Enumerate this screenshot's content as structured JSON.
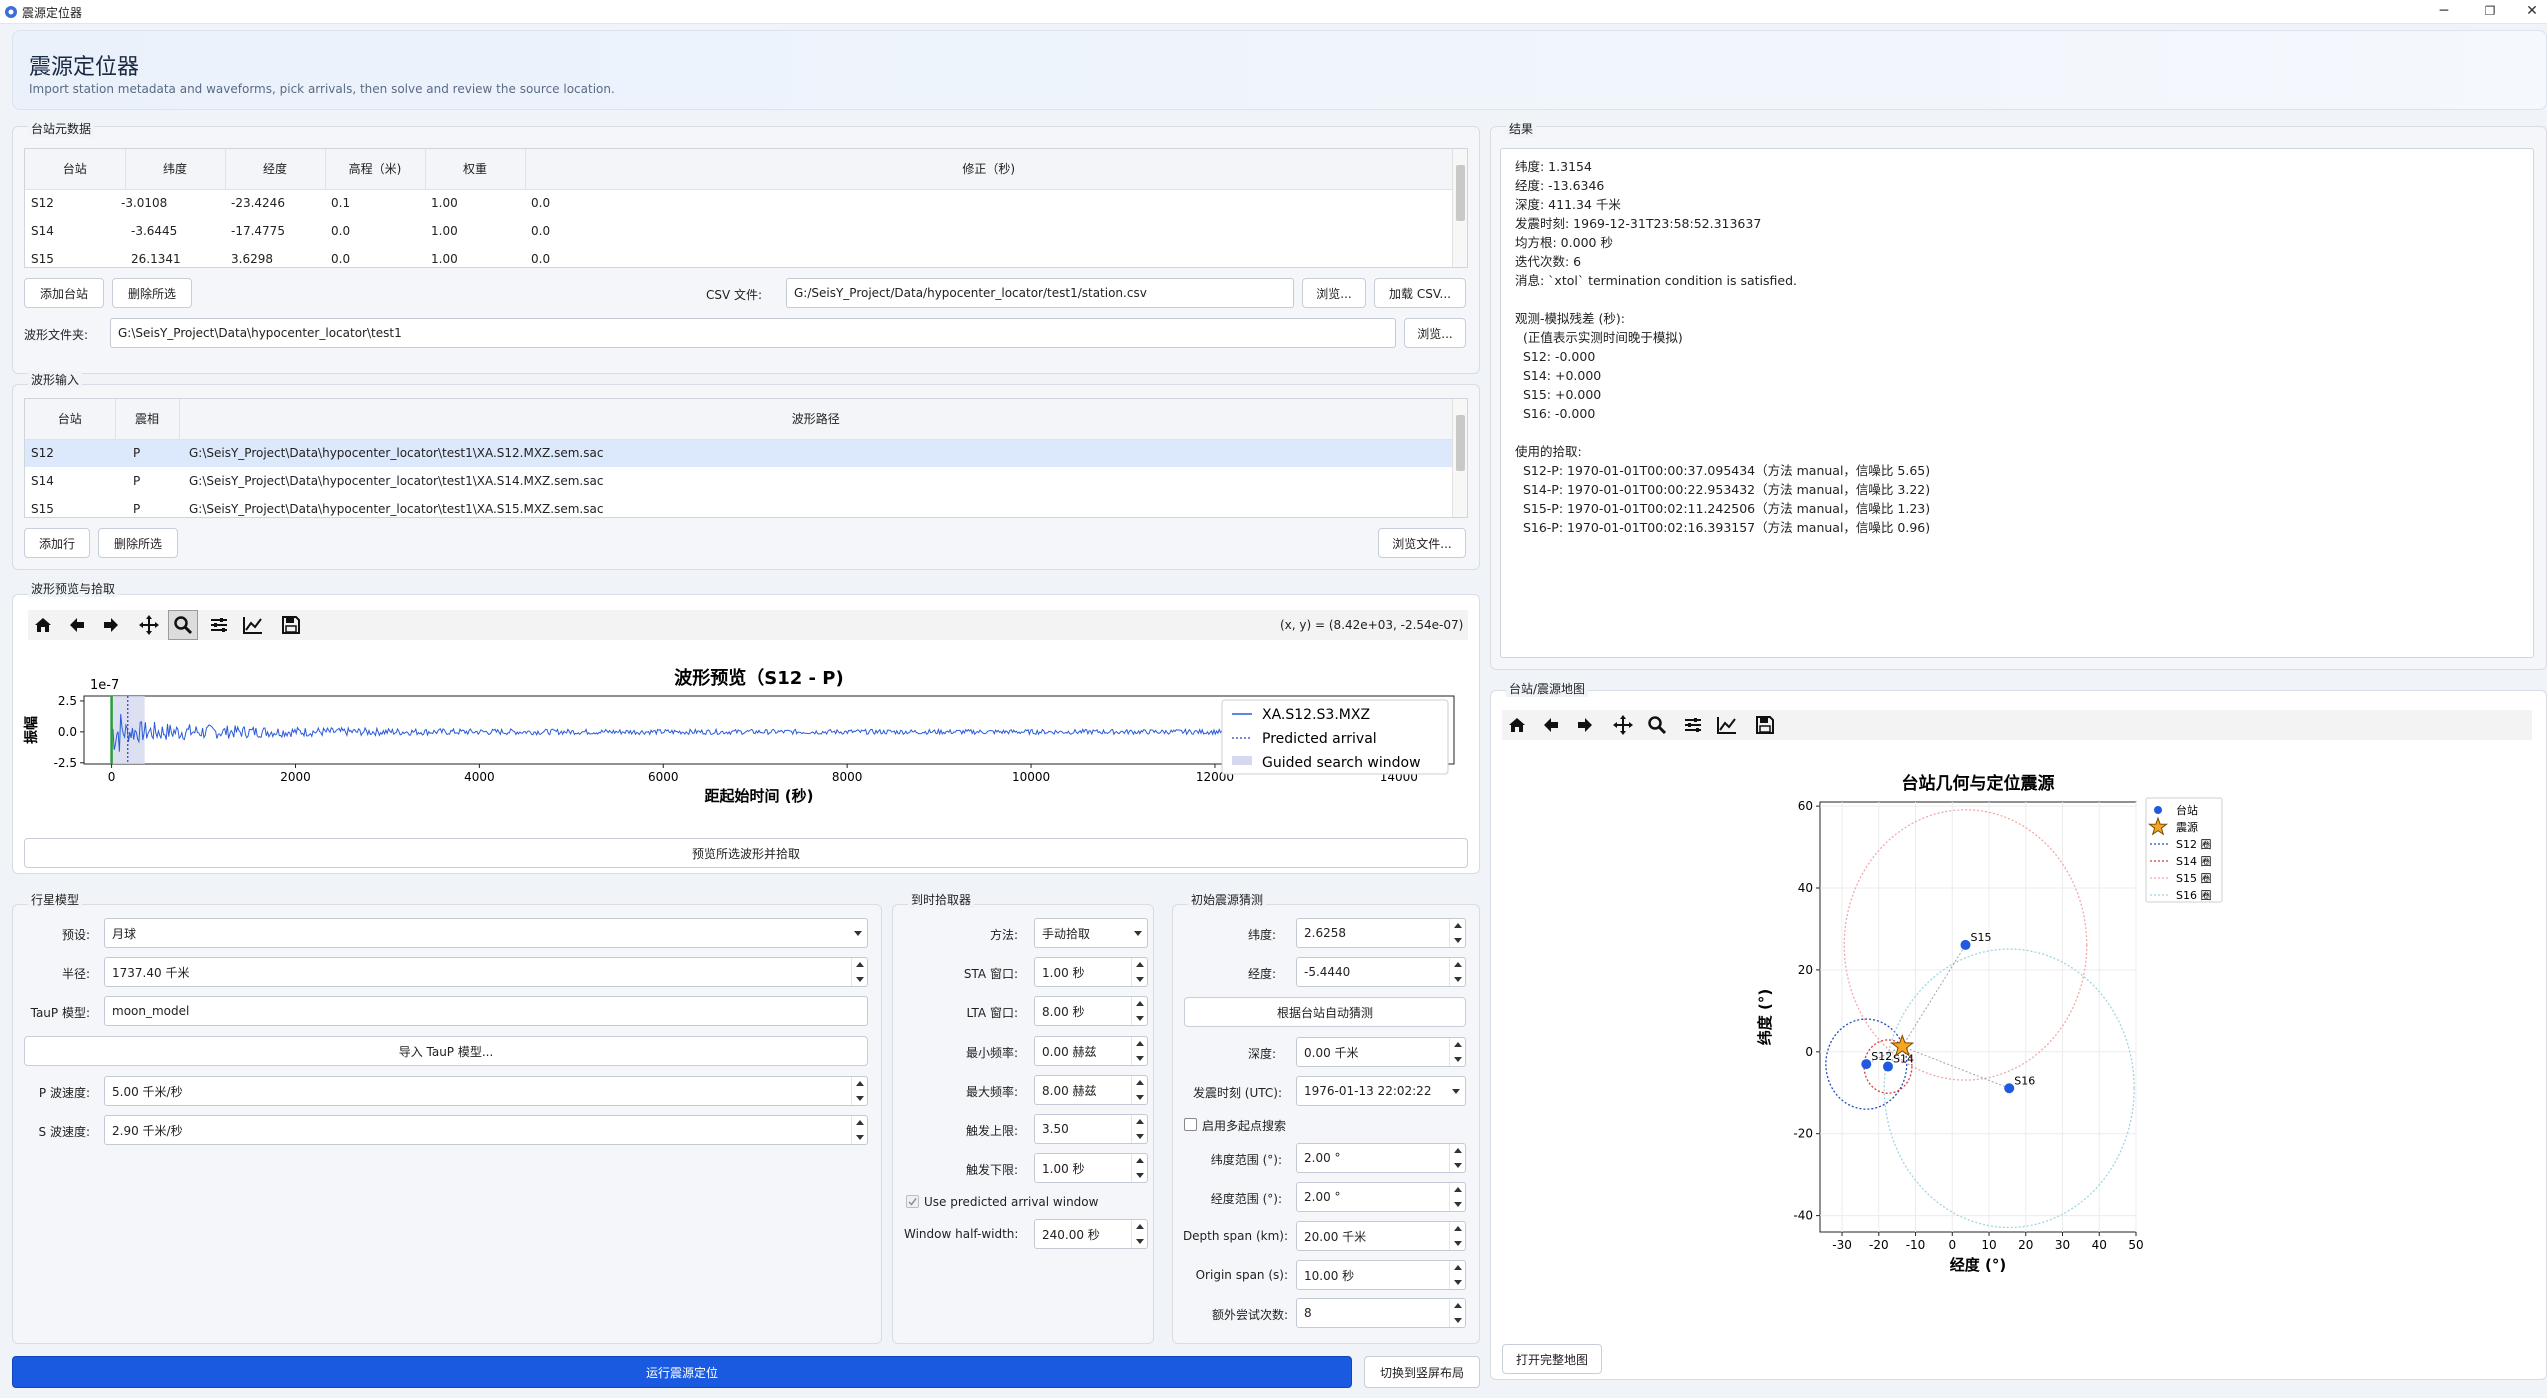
{
  "window": {
    "title": "震源定位器",
    "controls": {
      "minimize": "─",
      "maximize": "❐",
      "close": "✕"
    }
  },
  "header": {
    "title": "震源定位器",
    "subtitle": "Import station metadata and waveforms, pick arrivals, then solve and review the source location."
  },
  "stations": {
    "group_label": "台站元数据",
    "columns": [
      "台站",
      "纬度",
      "经度",
      "高程（米)",
      "权重",
      "修正（秒)"
    ],
    "rows": [
      [
        "S12",
        "-3.0108",
        "-23.4246",
        "0.1",
        "1.00",
        "0.0"
      ],
      [
        "S14",
        "-3.6445",
        "-17.4775",
        "0.0",
        "1.00",
        "0.0"
      ],
      [
        "S15",
        "26.1341",
        "3.6298",
        "0.0",
        "1.00",
        "0.0"
      ]
    ],
    "add_button": "添加台站",
    "delete_button": "删除所选",
    "csv_label": "CSV 文件:",
    "csv_path": "G:/SeisY_Project/Data/hypocenter_locator/test1/station.csv",
    "browse_button": "浏览...",
    "load_csv_button": "加载 CSV...",
    "waveform_folder_label": "波形文件夹:",
    "waveform_folder": "G:\\SeisY_Project\\Data\\hypocenter_locator\\test1",
    "browse_folder_button": "浏览..."
  },
  "waveforms": {
    "group_label": "波形输入",
    "columns": [
      "台站",
      "震相",
      "波形路径"
    ],
    "rows": [
      [
        "S12",
        "P",
        "G:\\SeisY_Project\\Data\\hypocenter_locator\\test1\\XA.S12.MXZ.sem.sac"
      ],
      [
        "S14",
        "P",
        "G:\\SeisY_Project\\Data\\hypocenter_locator\\test1\\XA.S14.MXZ.sem.sac"
      ],
      [
        "S15",
        "P",
        "G:\\SeisY_Project\\Data\\hypocenter_locator\\test1\\XA.S15.MXZ.sem.sac"
      ]
    ],
    "add_row_button": "添加行",
    "delete_button": "删除所选",
    "browse_files_button": "浏览文件..."
  },
  "preview": {
    "group_label": "波形预览与拾取",
    "coords_readout": "(x, y) = (8.42e+03, -2.54e-07)",
    "preview_button": "预览所选波形并拾取"
  },
  "preview_toolbar_icons": [
    "home-icon",
    "back-arrow-icon",
    "forward-arrow-icon",
    "pan-icon",
    "zoom-icon",
    "configure-subplots-icon",
    "edit-axis-icon",
    "save-icon"
  ],
  "map_toolbar_icons": [
    "home-icon",
    "back-arrow-icon",
    "forward-arrow-icon",
    "pan-icon",
    "zoom-icon",
    "configure-subplots-icon",
    "edit-axis-icon",
    "save-icon"
  ],
  "waveform_chart": {
    "type": "line",
    "title": "波形预览（S12 - P)",
    "xlabel": "距起始时间 (秒)",
    "ylabel": "振幅",
    "exponent_label": "1e-7",
    "xlim": [
      -300,
      14600
    ],
    "ylim": [
      -2.6,
      2.9
    ],
    "xticks": [
      0,
      2000,
      4000,
      6000,
      8000,
      10000,
      12000,
      14000
    ],
    "yticks": [
      2.5,
      0.0,
      -2.5
    ],
    "predicted_arrival_x": 176,
    "search_window": [
      0,
      360
    ],
    "pick_marker_x": 0,
    "legend": [
      "XA.S12.S3.MXZ",
      "Predicted arrival",
      "Guided search window"
    ]
  },
  "planet": {
    "group_label": "行星模型",
    "preset_label": "预设:",
    "preset_value": "月球",
    "radius_label": "半径:",
    "radius_value": "1737.40 千米",
    "taup_label": "TauP 模型:",
    "taup_value": "moon_model",
    "import_button": "导入 TauP 模型...",
    "vp_label": "P 波速度:",
    "vp_value": "5.00 千米/秒",
    "vs_label": "S 波速度:",
    "vs_value": "2.90 千米/秒"
  },
  "picker": {
    "group_label": "到时拾取器",
    "method_label": "方法:",
    "method_value": "手动拾取",
    "sta_label": "STA 窗口:",
    "sta_value": "1.00 秒",
    "lta_label": "LTA 窗口:",
    "lta_value": "8.00 秒",
    "fmin_label": "最小频率:",
    "fmin_value": "0.00 赫兹",
    "fmax_label": "最大频率:",
    "fmax_value": "8.00 赫兹",
    "trig_on_label": "触发上限:",
    "trig_on_value": "3.50",
    "trig_off_label": "触发下限:",
    "trig_off_value": "1.00 秒",
    "use_window_label": "Use predicted arrival window",
    "half_width_label": "Window half-width:",
    "half_width_value": "240.00 秒"
  },
  "initial_guess": {
    "group_label": "初始震源猜测",
    "lat_label": "纬度:",
    "lat_value": "2.6258",
    "lon_label": "经度:",
    "lon_value": "-5.4440",
    "auto_button": "根据台站自动猜测",
    "depth_label": "深度:",
    "depth_value": "0.00 千米",
    "origin_label": "发震时刻 (UTC):",
    "origin_value": "1976-01-13 22:02:22",
    "multistart_label": "启用多起点搜索",
    "lat_range_label": "纬度范围 (°):",
    "lat_range_value": "2.00 °",
    "lon_range_label": "经度范围 (°):",
    "lon_range_value": "2.00 °",
    "depth_span_label": "Depth span (km):",
    "depth_span_value": "20.00 千米",
    "origin_span_label": "Origin span (s):",
    "origin_span_value": "10.00 秒",
    "extra_label": "额外尝试次数:",
    "extra_value": "8"
  },
  "results": {
    "group_label": "结果",
    "text": "纬度: 1.3154\n经度: -13.6346\n深度: 411.34 千米\n发震时刻: 1969-12-31T23:58:52.313637\n均方根: 0.000 秒\n迭代次数: 6\n消息: `xtol` termination condition is satisfied.\n\n观测-模拟残差 (秒):\n  (正值表示实测时间晚于模拟)\n  S12: -0.000\n  S14: +0.000\n  S15: +0.000\n  S16: -0.000\n\n使用的拾取:\n  S12-P: 1970-01-01T00:00:37.095434（方法 manual，信噪比 5.65)\n  S14-P: 1970-01-01T00:00:22.953432（方法 manual，信噪比 3.22)\n  S15-P: 1970-01-01T00:02:11.242506（方法 manual，信噪比 1.23)\n  S16-P: 1970-01-01T00:02:16.393157（方法 manual，信噪比 0.96)"
  },
  "map": {
    "group_label": "台站/震源地图",
    "open_full_button": "打开完整地图"
  },
  "map_chart": {
    "type": "scatter",
    "title": "台站几何与定位震源",
    "xlabel": "经度 (°)",
    "ylabel": "纬度 (°)",
    "xlim": [
      -36,
      50
    ],
    "ylim": [
      -44,
      61
    ],
    "xticks": [
      -30,
      -20,
      -10,
      0,
      10,
      20,
      30,
      40,
      50
    ],
    "yticks": [
      60,
      40,
      20,
      0,
      -20,
      -40
    ],
    "stations": [
      {
        "name": "S12",
        "lon": -23.4,
        "lat": -3.0
      },
      {
        "name": "S14",
        "lon": -17.5,
        "lat": -3.6
      },
      {
        "name": "S15",
        "lon": 3.6,
        "lat": 26.1
      },
      {
        "name": "S16",
        "lon": 15.5,
        "lat": -8.9
      }
    ],
    "source": {
      "lon": -13.6,
      "lat": 1.3
    },
    "circles": [
      {
        "name": "S12 圈",
        "lon": -23.4,
        "lat": -3.0,
        "r": 11,
        "color": "#1f4fb5"
      },
      {
        "name": "S14 圈",
        "lon": -17.5,
        "lat": -3.6,
        "r": 6.5,
        "color": "#d63a3a"
      },
      {
        "name": "S15 圈",
        "lon": 3.6,
        "lat": 26.1,
        "r": 33,
        "color": "#f0a8a8"
      },
      {
        "name": "S16 圈",
        "lon": 15.5,
        "lat": -8.9,
        "r": 34,
        "color": "#9fd4e0"
      }
    ],
    "legend": [
      "台站",
      "震源",
      "S12 圈",
      "S14 圈",
      "S15 圈",
      "S16 圈"
    ],
    "colors": {
      "station": "#1f5ae0",
      "source_fill": "#f5a623",
      "source_edge": "#7a4a00"
    }
  },
  "actions": {
    "run_button": "运行震源定位",
    "layout_button": "切换到竖屏布局"
  },
  "colors": {
    "accent": "#1a5ae0",
    "waveform": "#2a5bd7"
  }
}
